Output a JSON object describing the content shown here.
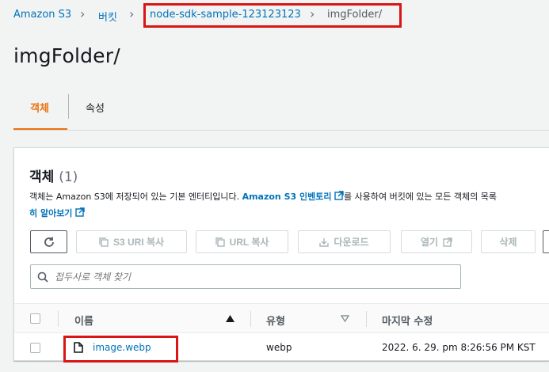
{
  "breadcrumb": {
    "items": [
      "Amazon S3",
      "버킷",
      "node-sdk-sample-123123123"
    ],
    "current": "imgFolder/"
  },
  "page_title": "imgFolder/",
  "tabs": [
    {
      "label": "객체",
      "active": true
    },
    {
      "label": "속성",
      "active": false
    }
  ],
  "objects_panel": {
    "heading": "객체",
    "count": "(1)",
    "description_prefix": "객체는 Amazon S3에 저장되어 있는 기본 엔터티입니다. ",
    "description_link": "Amazon S3 인벤토리",
    "description_suffix": "를 사용하여 버킷에 있는 모든 객체의 목록",
    "description_line2_link": "히 알아보기",
    "actions": {
      "refresh_icon": "refresh-icon",
      "copy_s3_uri": "S3 URI 복사",
      "copy_url": "URL 복사",
      "download": "다운로드",
      "open": "열기",
      "delete": "삭제"
    },
    "search": {
      "placeholder": "접두사로 객체 찾기"
    },
    "table": {
      "columns": [
        "이름",
        "유형",
        "마지막 수정"
      ],
      "rows": [
        {
          "name": "image.webp",
          "type": "webp",
          "last_modified": "2022. 6. 29. pm 8:26:56 PM KST"
        }
      ]
    }
  },
  "colors": {
    "link": "#0073bb",
    "accent": "#ec7211",
    "highlight_box": "#d91515"
  }
}
